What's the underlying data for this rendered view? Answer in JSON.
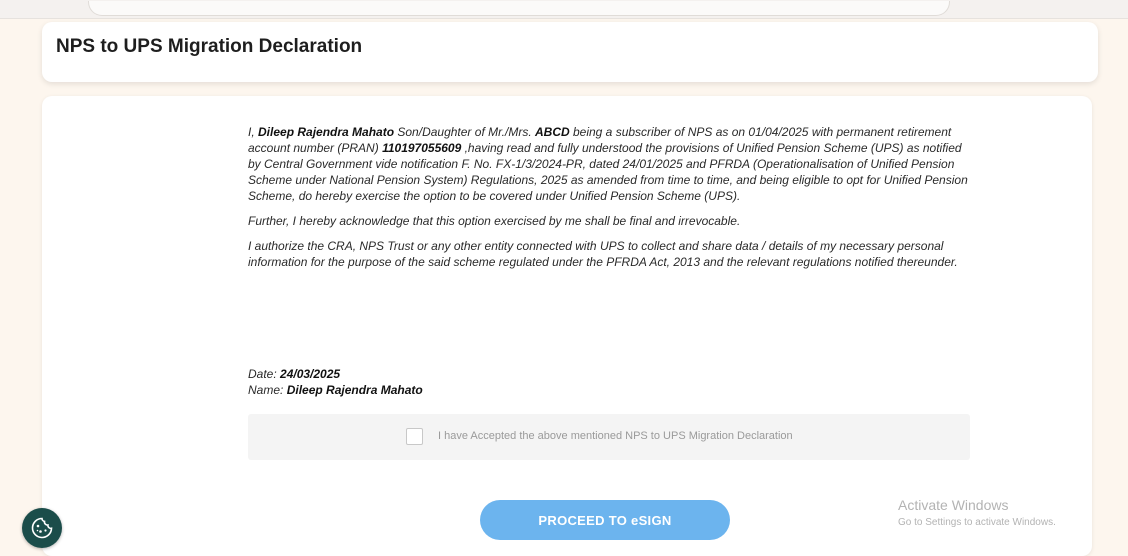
{
  "header": {
    "title": "NPS to UPS Migration Declaration"
  },
  "declaration": {
    "p1": {
      "t1": "I, ",
      "subscriber_name": "Dileep Rajendra Mahato",
      "t2": " Son/Daughter of Mr./Mrs. ",
      "parent_name": "ABCD",
      "t3": " being a subscriber of NPS as on 01/04/2025 with permanent retirement account number (PRAN) ",
      "pran": "110197055609",
      "t4": " ,having read and fully understood the provisions of Unified Pension Scheme (UPS) as notified by Central Government vide notification F. No. FX-1/3/2024-PR, dated 24/01/2025 and PFRDA (Operationalisation of Unified Pension Scheme under National Pension System) Regulations, 2025 as amended from time to time, and being eligible to opt for Unified Pension Scheme, do hereby exercise the option to be covered under Unified Pension Scheme (UPS)."
    },
    "p2": "Further, I hereby acknowledge that this option exercised by me shall be final and irrevocable.",
    "p3": "I authorize the CRA, NPS Trust or any other entity connected with UPS to collect and share data / details of my necessary personal information for the purpose of the said scheme regulated under the PFRDA Act, 2013 and the relevant regulations notified thereunder."
  },
  "meta": {
    "date_label": "Date: ",
    "date_value": "24/03/2025",
    "name_label": "Name: ",
    "name_value": "Dileep Rajendra Mahato"
  },
  "acceptance": {
    "label": "I have Accepted the above mentioned NPS to UPS Migration Declaration",
    "checked": false
  },
  "actions": {
    "proceed_label": "PROCEED TO eSIGN"
  },
  "watermark": {
    "title": "Activate Windows",
    "subtitle": "Go to Settings to activate Windows."
  },
  "icons": {
    "cookie": "cookie-icon"
  },
  "colors": {
    "primary_button": "#6cb4ee",
    "cookie_badge": "#1b4d4a"
  }
}
